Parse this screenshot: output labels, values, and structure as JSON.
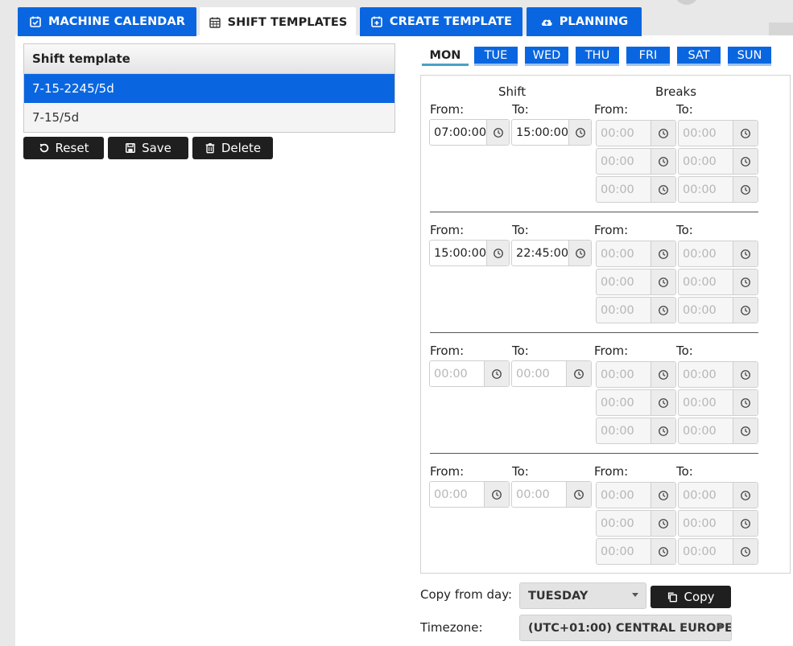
{
  "tabs": [
    {
      "label": "MACHINE CALENDAR",
      "icon": "calendar-check-icon"
    },
    {
      "label": "SHIFT TEMPLATES",
      "icon": "calendar-grid-icon"
    },
    {
      "label": "CREATE TEMPLATE",
      "icon": "calendar-plus-icon"
    },
    {
      "label": "PLANNING",
      "icon": "cloud-upload-icon"
    }
  ],
  "templates": {
    "header": "Shift template",
    "items": [
      "7-15-2245/5d",
      "7-15/5d"
    ]
  },
  "buttons": {
    "reset": "Reset",
    "save": "Save",
    "delete": "Delete",
    "copy": "Copy"
  },
  "days": [
    "MON",
    "TUE",
    "WED",
    "THU",
    "FRI",
    "SAT",
    "SUN"
  ],
  "schedule": {
    "shift_title": "Shift",
    "breaks_title": "Breaks",
    "from_label": "From:",
    "to_label": "To:",
    "placeholder": "00:00",
    "shifts": [
      {
        "from": "07:00:00",
        "to": "15:00:00"
      },
      {
        "from": "15:00:00",
        "to": "22:45:00"
      },
      {
        "from": "",
        "to": ""
      },
      {
        "from": "",
        "to": ""
      }
    ]
  },
  "copy_from": {
    "label": "Copy from day:",
    "value": "TUESDAY"
  },
  "timezone": {
    "label": "Timezone:",
    "value": "(UTC+01:00) CENTRAL EUROPE ..."
  },
  "colors": {
    "accent": "#0a66e0",
    "dark_button": "#1f1f1f"
  }
}
